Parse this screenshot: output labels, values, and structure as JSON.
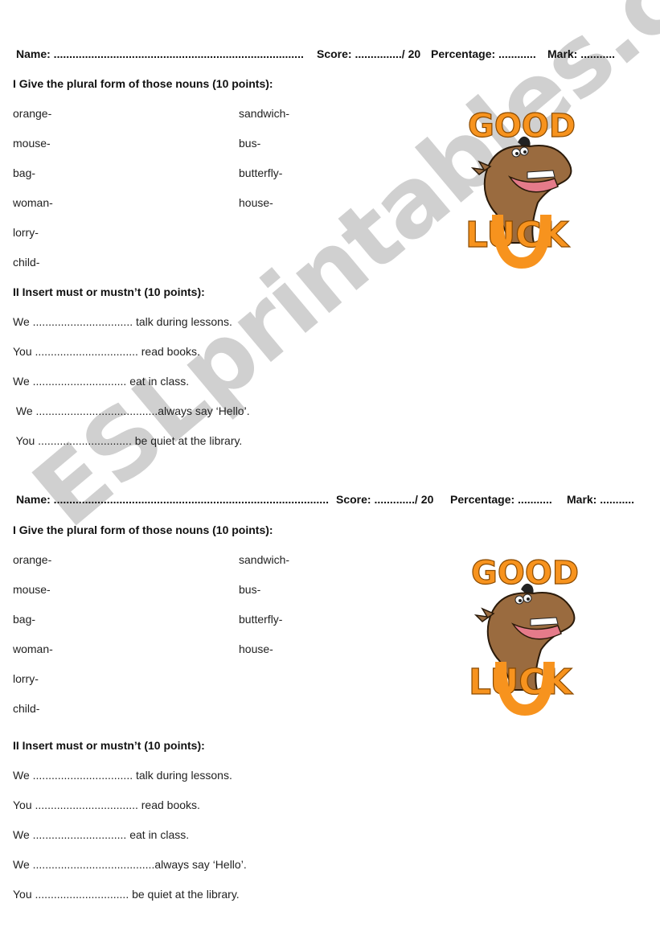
{
  "watermark": "ESLprintables.com",
  "sections": [
    {
      "header": {
        "name": "Name: ................................................................................",
        "score": "Score: .............../ 20",
        "percentage": "Percentage: ............",
        "mark": "Mark: ..........."
      },
      "exercise1": {
        "title": "I Give the plural form of those nouns (10 points):",
        "left_column": [
          "orange-",
          "mouse-",
          "bag-",
          "woman-",
          "lorry-",
          "child-"
        ],
        "right_column": [
          "sandwich-",
          "bus-",
          "butterfly-",
          "house-"
        ]
      },
      "exercise2": {
        "title": "II Insert must or mustn’t (10 points):",
        "sentences": [
          "We ................................ talk during lessons.",
          "You ................................. read books.",
          "We .............................. eat in class.",
          " We .......................................always say ‘Hello’.",
          " You .............................. be quiet at the library."
        ]
      },
      "logo": {
        "top_text": "GOOD",
        "bottom_text": "LUCK"
      }
    },
    {
      "header": {
        "name": "Name: ........................................................................................",
        "score": "Score: ............./ 20",
        "percentage": "Percentage: ...........",
        "mark": "Mark: ..........."
      },
      "exercise1": {
        "title": "I Give the plural form of those nouns (10 points):",
        "left_column": [
          "orange-",
          "mouse-",
          "bag-",
          "woman-",
          "lorry-",
          "child-"
        ],
        "right_column": [
          "sandwich-",
          "bus-",
          "butterfly-",
          "house-"
        ]
      },
      "exercise2": {
        "title": "II Insert must or mustn’t (10 points):",
        "sentences": [
          "We ................................ talk during lessons.",
          "You ................................. read books.",
          "We .............................. eat in class.",
          "We .......................................always say ‘Hello’.",
          "You .............................. be quiet at the library."
        ]
      },
      "logo": {
        "top_text": "GOOD",
        "bottom_text": "LUCK"
      }
    }
  ],
  "colors": {
    "logo_orange": "#f7931e",
    "horse_brown": "#9a6b3f",
    "watermark_gray": "#c8c8c8"
  }
}
